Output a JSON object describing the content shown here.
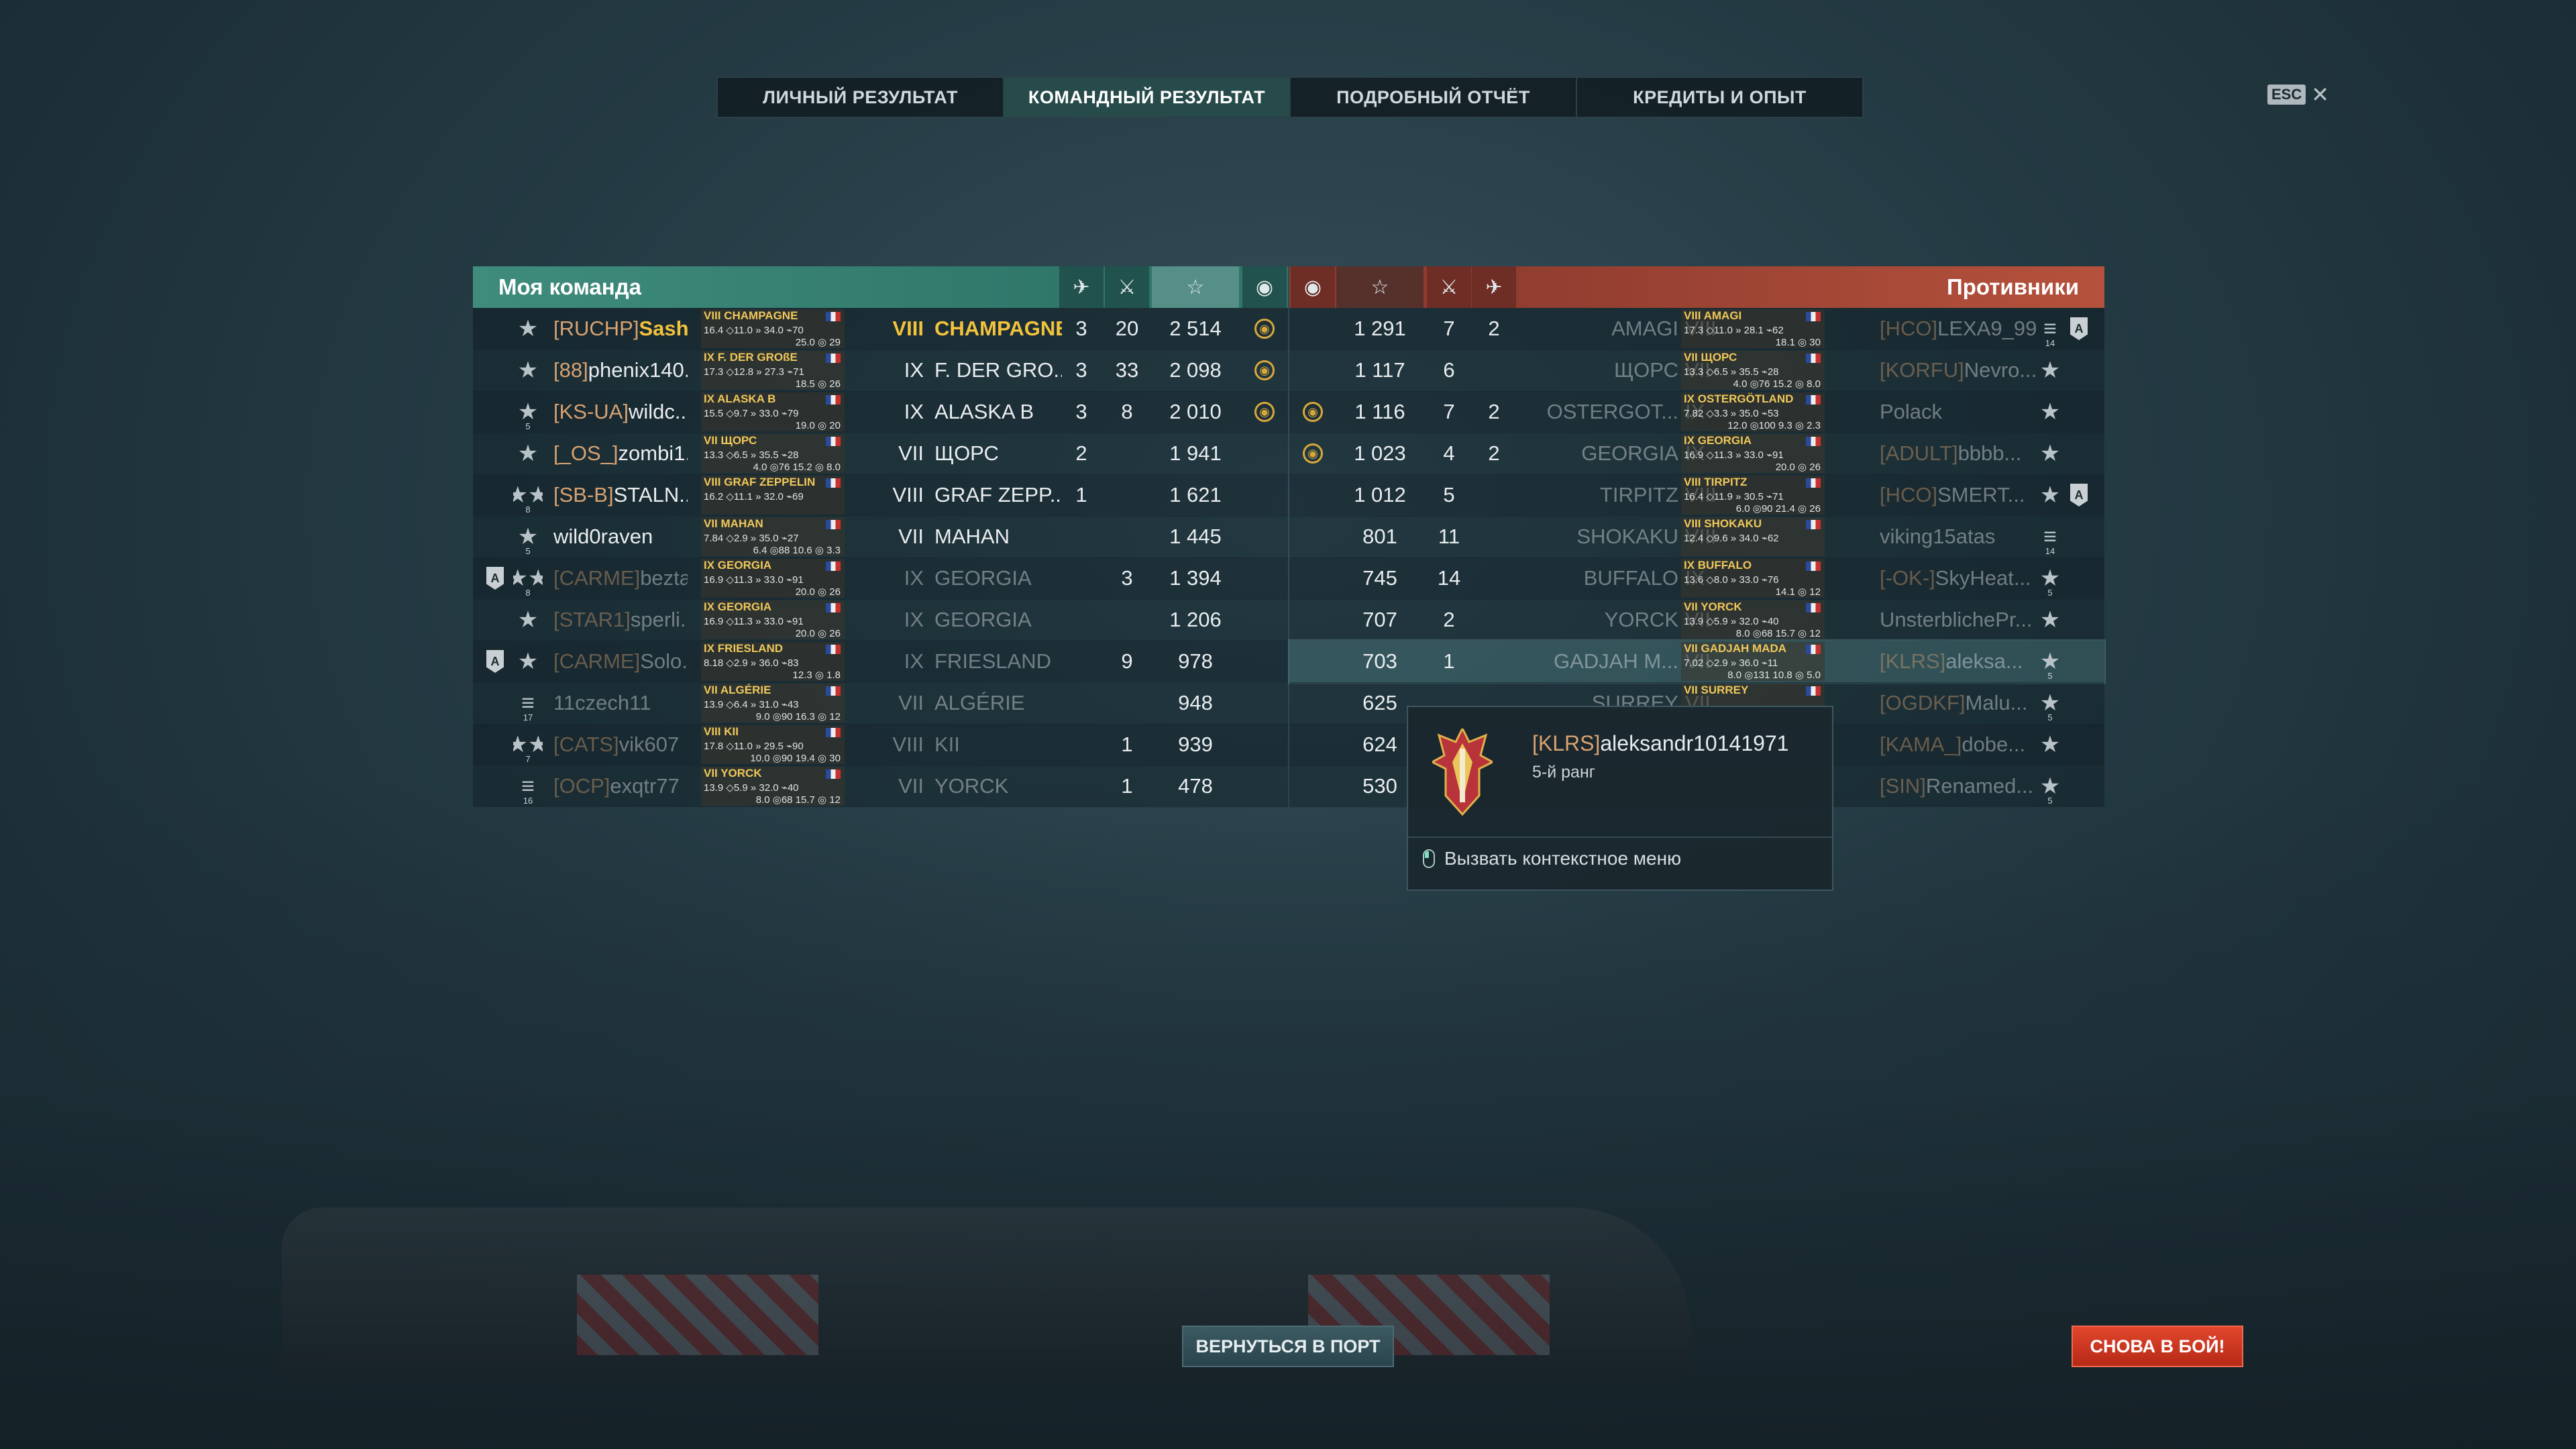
{
  "tabs": [
    {
      "label": "ЛИЧНЫЙ РЕЗУЛЬТАТ",
      "active": false
    },
    {
      "label": "КОМАНДНЫЙ РЕЗУЛЬТАТ",
      "active": true
    },
    {
      "label": "ПОДРОБНЫЙ ОТЧЁТ",
      "active": false
    },
    {
      "label": "КРЕДИТЫ И ОПЫТ",
      "active": false
    }
  ],
  "esc": {
    "key": "ESC",
    "close": "✕"
  },
  "my_team": {
    "title": "Моя команда",
    "columns": {
      "planes": "✈",
      "kills": "⚔",
      "xp": "☆",
      "base": "◉"
    },
    "rows": [
      {
        "rank": "★",
        "clan": "[RUCHP]",
        "player": "Sashelo",
        "player_gold": true,
        "card": {
          "name": "VIII CHAMPAGNE",
          "s1": "16.4 ◇11.0 » 34.0 ⌁70",
          "s2": "25.0 ◎ 29"
        },
        "tier": "VIII",
        "ship": "CHAMPAGNE",
        "ship_gold": true,
        "planes": "3",
        "kills": "20",
        "xp": "2 514",
        "base": "◉",
        "dim": false
      },
      {
        "rank": "★",
        "clan": "[88]",
        "player": "phenix140...",
        "card": {
          "name": "IX F. DER GROßE",
          "s1": "17.3 ◇12.8 » 27.3 ⌁71",
          "s2": "18.5 ◎ 26"
        },
        "tier": "IX",
        "ship": "F. DER GRO...",
        "planes": "3",
        "kills": "33",
        "xp": "2 098",
        "base": "◉",
        "dim": false
      },
      {
        "rank": "★",
        "rank_num": "5",
        "clan": "[KS-UA]",
        "player": "wildc...",
        "card": {
          "name": "IX ALASKA B",
          "s1": "15.5 ◇9.7 » 33.0 ⌁79",
          "s2": "19.0 ◎ 20"
        },
        "tier": "IX",
        "ship": "ALASKA B",
        "planes": "3",
        "kills": "8",
        "xp": "2 010",
        "base": "◉",
        "dim": false
      },
      {
        "rank": "★",
        "clan": "[_OS_]",
        "player": "zombi1...",
        "card": {
          "name": "VII ЩОРС",
          "s1": "13.3 ◇6.5 » 35.5 ⌁28",
          "s2": "4.0 ◎76 15.2 ◎ 8.0"
        },
        "tier": "VII",
        "ship": "ЩОРС",
        "planes": "2",
        "kills": "",
        "xp": "1 941",
        "base": "",
        "dim": false
      },
      {
        "rank": "★★",
        "rank_num": "8",
        "clan": "[SB-B]",
        "player": "STALN...",
        "card": {
          "name": "VIII GRAF ZEPPELIN",
          "s1": "16.2 ◇11.1 » 32.0 ⌁69",
          "s2": ""
        },
        "tier": "VIII",
        "ship": "GRAF ZEPP...",
        "planes": "1",
        "kills": "",
        "xp": "1 621",
        "base": "",
        "dim": false
      },
      {
        "rank": "★",
        "rank_num": "5",
        "clan": "",
        "player": "wild0raven",
        "card": {
          "name": "VII MAHAN",
          "s1": "7.84 ◇2.9 » 35.0 ⌁27",
          "s2": "6.4 ◎88 10.6 ◎ 3.3"
        },
        "tier": "VII",
        "ship": "MAHAN",
        "planes": "",
        "kills": "",
        "xp": "1 445",
        "base": "",
        "dim": false
      },
      {
        "rank": "★★",
        "rank_num": "8",
        "badge": "A",
        "clan": "[CARME]",
        "player": "bezta...",
        "card": {
          "name": "IX GEORGIA",
          "s1": "16.9 ◇11.3 » 33.0 ⌁91",
          "s2": "20.0 ◎ 26"
        },
        "tier": "IX",
        "ship": "GEORGIA",
        "planes": "",
        "kills": "3",
        "xp": "1 394",
        "base": "",
        "dim": true
      },
      {
        "rank": "★",
        "clan": "[STAR1]",
        "player": "sperli...",
        "card": {
          "name": "IX GEORGIA",
          "s1": "16.9 ◇11.3 » 33.0 ⌁91",
          "s2": "20.0 ◎ 26"
        },
        "tier": "IX",
        "ship": "GEORGIA",
        "planes": "",
        "kills": "",
        "xp": "1 206",
        "base": "",
        "dim": true
      },
      {
        "rank": "★",
        "badge": "A",
        "clan": "[CARME]",
        "player": "Solo...",
        "card": {
          "name": "IX FRIESLAND",
          "s1": "8.18 ◇2.9 » 36.0 ⌁83",
          "s2": "12.3 ◎ 1.8"
        },
        "tier": "IX",
        "ship": "FRIESLAND",
        "planes": "",
        "kills": "9",
        "xp": "978",
        "base": "",
        "dim": true
      },
      {
        "rank": "≡",
        "rank_num": "17",
        "clan": "",
        "player": "11czech11",
        "card": {
          "name": "VII ALGÉRIE",
          "s1": "13.9 ◇6.4 » 31.0 ⌁43",
          "s2": "9.0 ◎90 16.3 ◎ 12"
        },
        "tier": "VII",
        "ship": "ALGÉRIE",
        "planes": "",
        "kills": "",
        "xp": "948",
        "base": "",
        "dim": true
      },
      {
        "rank": "★★",
        "rank_num": "7",
        "clan": "[CATS]",
        "player": "vik607",
        "card": {
          "name": "VIII KII",
          "s1": "17.8 ◇11.0 » 29.5 ⌁90",
          "s2": "10.0 ◎90 19.4 ◎ 30"
        },
        "tier": "VIII",
        "ship": "KII",
        "planes": "",
        "kills": "1",
        "xp": "939",
        "base": "",
        "dim": true
      },
      {
        "rank": "≡",
        "rank_num": "16",
        "clan": "[OCP]",
        "player": "exqtr77",
        "card": {
          "name": "VII YORCK",
          "s1": "13.9 ◇5.9 » 32.0 ⌁40",
          "s2": "8.0 ◎68 15.7 ◎ 12"
        },
        "tier": "VII",
        "ship": "YORCK",
        "planes": "",
        "kills": "1",
        "xp": "478",
        "base": "",
        "dim": true
      }
    ]
  },
  "enemy_team": {
    "title": "Противники",
    "rows": [
      {
        "base": "",
        "xp": "1 291",
        "kills": "7",
        "planes": "2",
        "ship": "AMAGI",
        "tier": "VIII",
        "card": {
          "name": "VIII AMAGI",
          "s1": "17.3 ◇11.0 » 28.1 ⌁62",
          "s2": "18.1 ◎ 30"
        },
        "clan": "[HCO]",
        "player": "LEXA9_99",
        "rank": "≡",
        "rank_num": "14",
        "badge": "A",
        "dim": true
      },
      {
        "base": "",
        "xp": "1 117",
        "kills": "6",
        "planes": "",
        "ship": "ЩОРС",
        "tier": "VII",
        "card": {
          "name": "VII ЩОРС",
          "s1": "13.3 ◇6.5 » 35.5 ⌁28",
          "s2": "4.0 ◎76 15.2 ◎ 8.0"
        },
        "clan": "[KORFU]",
        "player": "Nevro...",
        "rank": "★",
        "dim": true
      },
      {
        "base": "◉",
        "xp": "1 116",
        "kills": "7",
        "planes": "2",
        "ship": "OSTERGOT...",
        "tier": "IX",
        "card": {
          "name": "IX OSTERGÖTLAND",
          "s1": "7.82 ◇3.3 » 35.0 ⌁53",
          "s2": "12.0 ◎100 9.3 ◎ 2.3"
        },
        "clan": "",
        "player": "Polack",
        "rank": "★",
        "dim": true
      },
      {
        "base": "◉",
        "xp": "1 023",
        "kills": "4",
        "planes": "2",
        "ship": "GEORGIA",
        "tier": "IX",
        "card": {
          "name": "IX GEORGIA",
          "s1": "16.9 ◇11.3 » 33.0 ⌁91",
          "s2": "20.0 ◎ 26"
        },
        "clan": "[ADULT]",
        "player": "bbbb...",
        "rank": "★",
        "dim": true
      },
      {
        "base": "",
        "xp": "1 012",
        "kills": "5",
        "planes": "",
        "ship": "TIRPITZ",
        "tier": "VIII",
        "card": {
          "name": "VIII TIRPITZ",
          "s1": "16.4 ◇11.9 » 30.5 ⌁71",
          "s2": "6.0 ◎90 21.4 ◎ 26"
        },
        "clan": "[HCO]",
        "player": "SMERT...",
        "rank": "★",
        "badge": "A",
        "dim": true
      },
      {
        "base": "",
        "xp": "801",
        "kills": "11",
        "planes": "",
        "ship": "SHOKAKU",
        "tier": "VIII",
        "card": {
          "name": "VIII SHOKAKU",
          "s1": "12.4 ◇9.6 » 34.0 ⌁62",
          "s2": ""
        },
        "clan": "",
        "player": "viking15atas",
        "rank": "≡",
        "rank_num": "14",
        "dim": true
      },
      {
        "base": "",
        "xp": "745",
        "kills": "14",
        "planes": "",
        "ship": "BUFFALO",
        "tier": "IX",
        "card": {
          "name": "IX BUFFALO",
          "s1": "13.6 ◇8.0 » 33.0 ⌁76",
          "s2": "14.1 ◎ 12"
        },
        "clan": "[-OK-]",
        "player": "SkyHeat...",
        "rank": "★",
        "rank_num": "5",
        "dim": true
      },
      {
        "base": "",
        "xp": "707",
        "kills": "2",
        "planes": "",
        "ship": "YORCK",
        "tier": "VII",
        "card": {
          "name": "VII YORCK",
          "s1": "13.9 ◇5.9 » 32.0 ⌁40",
          "s2": "8.0 ◎68 15.7 ◎ 12"
        },
        "clan": "",
        "player": "UnsterblichePr...",
        "rank": "★",
        "dim": true
      },
      {
        "base": "",
        "xp": "703",
        "kills": "1",
        "planes": "",
        "ship": "GADJAH M...",
        "tier": "VII",
        "card": {
          "name": "VII GADJAH MADA",
          "s1": "7.02 ◇2.9 » 36.0 ⌁11",
          "s2": "8.0 ◎131 10.8 ◎ 5.0"
        },
        "clan": "[KLRS]",
        "player": "aleksa...",
        "rank": "★",
        "rank_num": "5",
        "dim": true,
        "highlight": true
      },
      {
        "base": "",
        "xp": "625",
        "kills": "",
        "planes": "",
        "ship": "SURREY",
        "tier": "VII",
        "card": {
          "name": "VII SURREY",
          "s1": "",
          "s2": ""
        },
        "clan": "[OGDKF]",
        "player": "Malu...",
        "rank": "★",
        "rank_num": "5",
        "dim": true
      },
      {
        "base": "",
        "xp": "624",
        "kills": "",
        "planes": "",
        "ship": "",
        "tier": "",
        "card": null,
        "clan": "[KAMA_]",
        "player": "dobe...",
        "rank": "★",
        "dim": true
      },
      {
        "base": "",
        "xp": "530",
        "kills": "",
        "planes": "",
        "ship": "",
        "tier": "",
        "card": null,
        "clan": "[SIN]",
        "player": "Renamed...",
        "rank": "★",
        "rank_num": "5",
        "dim": true
      }
    ]
  },
  "tooltip": {
    "clan": "[KLRS]",
    "player": "aleksandr10141971",
    "rank": "5-й ранг",
    "action": "Вызвать контекстное меню"
  },
  "buttons": {
    "port": "ВЕРНУТЬСЯ В ПОРТ",
    "battle": "СНОВА В БОЙ!"
  },
  "colors": {
    "my_team_header": "#3f8c7c",
    "enemy_header": "#b5513c",
    "highlight_gold": "#f2c23c",
    "clan_tag": "#d8a270",
    "battle_button": "#d63b24"
  }
}
